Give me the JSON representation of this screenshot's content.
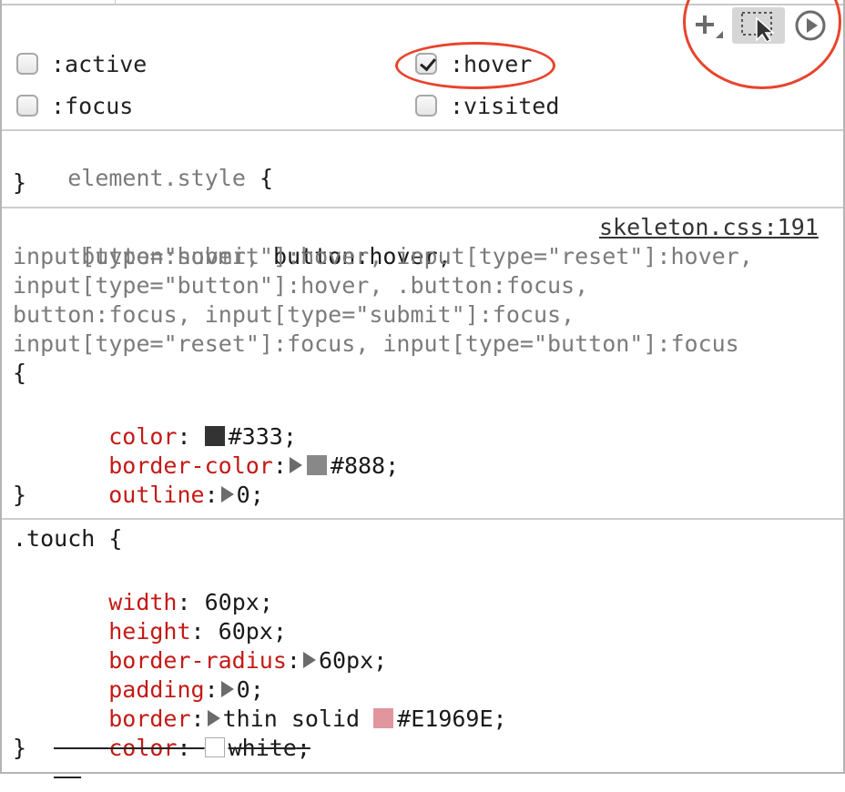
{
  "toolbar": {
    "new_rule_icon": "plus-icon",
    "element_picker_icon": "element-state-icon",
    "animations_icon": "play-circle-icon"
  },
  "states": [
    {
      "label": ":active",
      "checked": false
    },
    {
      "label": ":hover",
      "checked": true
    },
    {
      "label": ":focus",
      "checked": false
    },
    {
      "label": ":visited",
      "checked": false
    }
  ],
  "element_style": {
    "selector": "element.style",
    "open": " {",
    "close": "}"
  },
  "rule1": {
    "source": "skeleton.css:191",
    "sel_line1_a": ".button:hover, ",
    "sel_line1_b": "button:hover,",
    "sel_line2": "input[type=\"submit\"]:hover, input[type=\"reset\"]:hover,",
    "sel_line3": "input[type=\"button\"]:hover, .button:focus,",
    "sel_line4": "button:focus, input[type=\"submit\"]:focus,",
    "sel_line5": "input[type=\"reset\"]:focus, input[type=\"button\"]:focus",
    "open": "{",
    "close": "}",
    "decls": [
      {
        "prop": "color",
        "value": "#333",
        "swatch": "#333333"
      },
      {
        "prop": "border-color",
        "value": "#888",
        "swatch": "#888888"
      },
      {
        "prop": "outline",
        "value": "0"
      }
    ]
  },
  "rule2": {
    "selector": ".touch {",
    "close": "}",
    "decls": [
      {
        "prop": "width",
        "value": "60px"
      },
      {
        "prop": "height",
        "value": "60px"
      },
      {
        "prop": "border-radius",
        "value": "60px"
      },
      {
        "prop": "padding",
        "value": "0"
      },
      {
        "prop": "border",
        "value_a": "thin solid ",
        "value_b": "#E1969E",
        "swatch": "#E1969E"
      },
      {
        "prop": "color",
        "value": "white",
        "swatch": "#ffffff",
        "overridden": true
      }
    ]
  },
  "colors": {
    "annotation": "#e8442c",
    "property": "#c41a16",
    "selector_gray": "#7b7b7b"
  }
}
